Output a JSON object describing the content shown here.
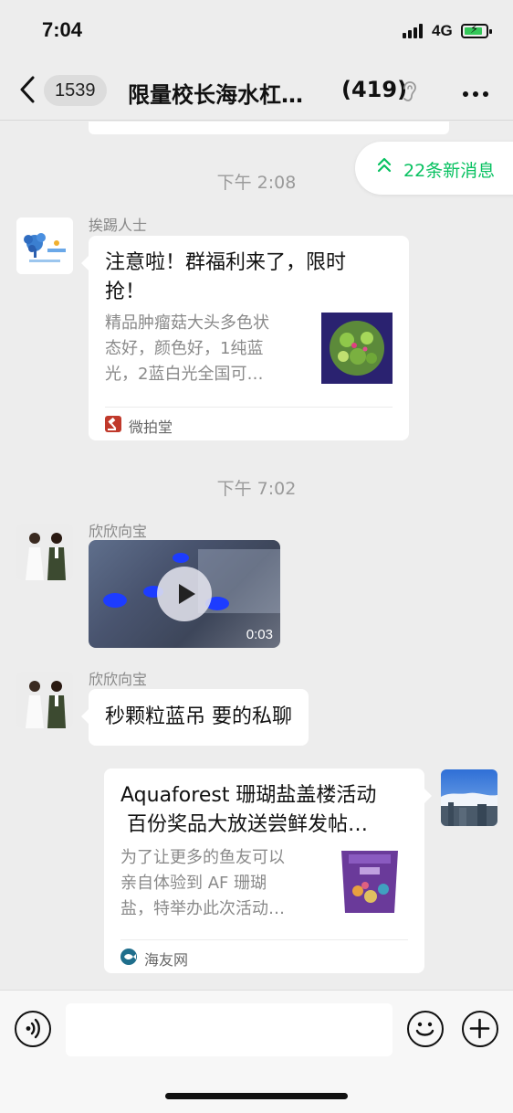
{
  "status_bar": {
    "time": "7:04",
    "network": "4G"
  },
  "nav": {
    "back_icon": "chevron-left-icon",
    "unread_badge": "1539",
    "title": "限量校长海水杠…",
    "member_count": "(419)",
    "mute_icon": "ear-icon",
    "more_icon": "more-dots-icon"
  },
  "new_messages": {
    "label": "22条新消息",
    "icon": "double-chevron-up-icon",
    "color": "#07c160"
  },
  "messages": [
    {
      "type": "timestamp",
      "text": "下午 2:08"
    },
    {
      "type": "link_card",
      "sender": "挨踢人士",
      "title": "注意啦！群福利来了，限时抢！",
      "title_line1": "注意啦！群福利来了，限时",
      "title_line2": "抢！",
      "description": "精品肿瘤菇大头多色状态好，颜色好，1纯蓝光，2蓝白光全国可…",
      "desc_line1": "精品肿瘤菇大头多色状",
      "desc_line2": "态好，颜色好，1纯蓝",
      "desc_line3": "光，2蓝白光全国可…",
      "source": "微拍堂",
      "source_icon": "gavel-icon"
    },
    {
      "type": "timestamp",
      "text": "下午 7:02"
    },
    {
      "type": "video",
      "sender": "欣欣向宝",
      "duration": "0:03"
    },
    {
      "type": "text",
      "sender": "欣欣向宝",
      "text": "秒颗粒蓝吊 要的私聊"
    },
    {
      "type": "link_card_self",
      "title_line1": "Aquaforest 珊瑚盐盖楼活动",
      "title_line2": " 百份奖品大放送尝鲜发帖…",
      "desc_line1": "为了让更多的鱼友可以",
      "desc_line2": "亲自体验到 AF 珊瑚",
      "desc_line3": "盐，特举办此次活动…",
      "source": "海友网",
      "source_icon": "fish-logo-icon"
    }
  ],
  "input_bar": {
    "voice_icon": "voice-icon",
    "emoji_icon": "emoji-icon",
    "plus_icon": "plus-icon",
    "message_value": ""
  }
}
